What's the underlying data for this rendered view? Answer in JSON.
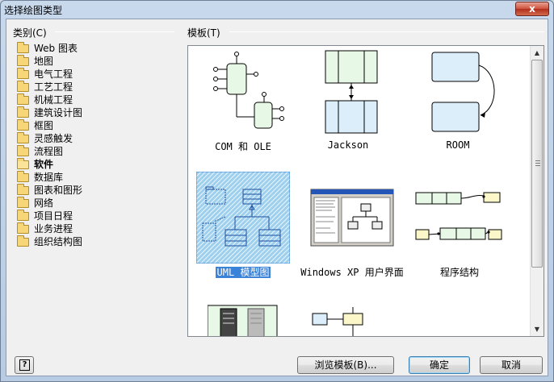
{
  "window": {
    "title": "选择绘图类型",
    "close_symbol": "x"
  },
  "categories_group": {
    "label": "类别(C)",
    "items": [
      {
        "label": "Web 图表",
        "selected": false
      },
      {
        "label": "地图",
        "selected": false
      },
      {
        "label": "电气工程",
        "selected": false
      },
      {
        "label": "工艺工程",
        "selected": false
      },
      {
        "label": "机械工程",
        "selected": false
      },
      {
        "label": "建筑设计图",
        "selected": false
      },
      {
        "label": "框图",
        "selected": false
      },
      {
        "label": "灵感触发",
        "selected": false
      },
      {
        "label": "流程图",
        "selected": false
      },
      {
        "label": "软件",
        "selected": true
      },
      {
        "label": "数据库",
        "selected": false
      },
      {
        "label": "图表和图形",
        "selected": false
      },
      {
        "label": "网络",
        "selected": false
      },
      {
        "label": "项目日程",
        "selected": false
      },
      {
        "label": "业务进程",
        "selected": false
      },
      {
        "label": "组织结构图",
        "selected": false
      }
    ]
  },
  "templates_group": {
    "label": "模板(T)",
    "templates": [
      {
        "caption": "COM 和 OLE",
        "selected": false
      },
      {
        "caption": "Jackson",
        "selected": false
      },
      {
        "caption": "ROOM",
        "selected": false
      },
      {
        "caption": "UML 模型图",
        "selected": true
      },
      {
        "caption": "Windows XP 用户界面",
        "selected": false
      },
      {
        "caption": "程序结构",
        "selected": false
      }
    ]
  },
  "buttons": {
    "help": "?",
    "browse": "浏览模板(B)...",
    "ok": "确定",
    "cancel": "取消"
  },
  "colors": {
    "selection": "#3a83d9",
    "folder": "#f6d676",
    "light_green": "#e8f8e6",
    "light_blue": "#dceefa",
    "light_yellow": "#fbf7c8"
  }
}
